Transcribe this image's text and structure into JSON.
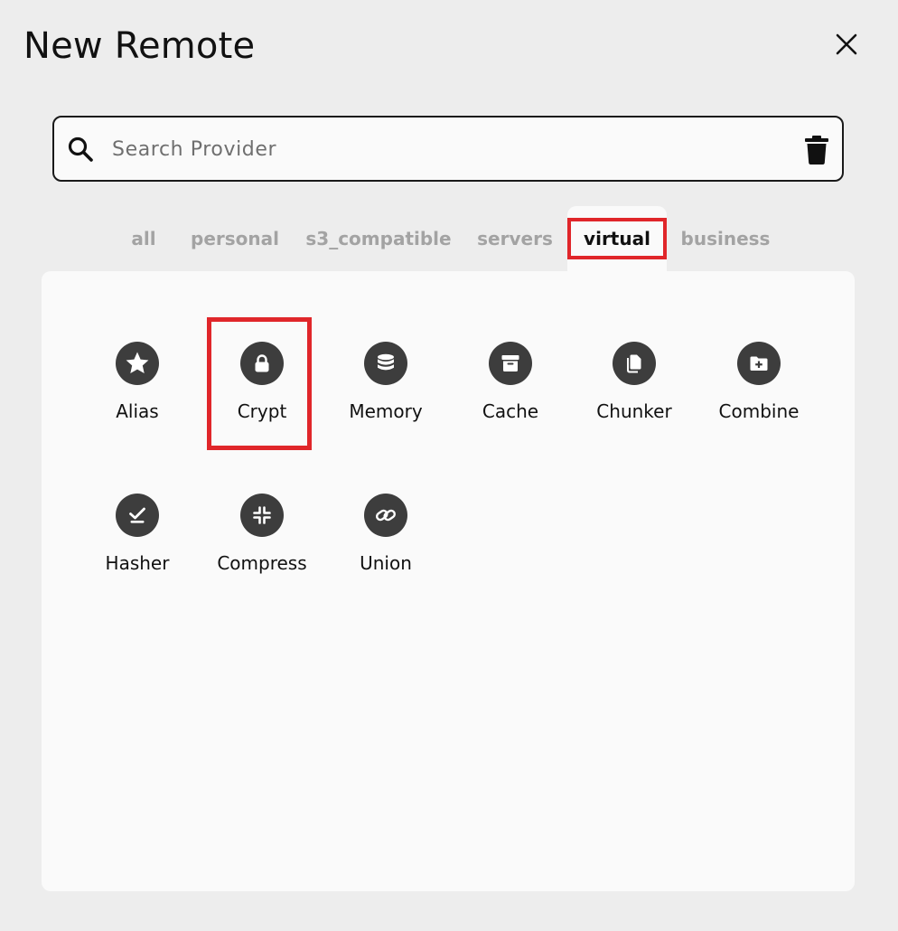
{
  "dialog": {
    "title": "New Remote",
    "close_icon": "close-icon"
  },
  "search": {
    "placeholder": "Search Provider",
    "value": "",
    "search_icon": "search-icon",
    "clear_icon": "trash-icon"
  },
  "tabs": [
    {
      "label": "all",
      "active": false
    },
    {
      "label": "personal",
      "active": false
    },
    {
      "label": "s3_compatible",
      "active": false
    },
    {
      "label": "servers",
      "active": false
    },
    {
      "label": "virtual",
      "active": true
    },
    {
      "label": "business",
      "active": false
    }
  ],
  "providers": [
    {
      "label": "Alias",
      "icon": "star-icon"
    },
    {
      "label": "Crypt",
      "icon": "lock-icon",
      "highlighted": true
    },
    {
      "label": "Memory",
      "icon": "database-icon"
    },
    {
      "label": "Cache",
      "icon": "archive-icon"
    },
    {
      "label": "Chunker",
      "icon": "copy-icon"
    },
    {
      "label": "Combine",
      "icon": "folder-plus-icon"
    },
    {
      "label": "Hasher",
      "icon": "check-badge-icon"
    },
    {
      "label": "Compress",
      "icon": "compress-icon"
    },
    {
      "label": "Union",
      "icon": "link-icon"
    }
  ],
  "colors": {
    "highlight": "#e0262a",
    "icon_bg": "#3d3d3d",
    "panel_bg": "#fafafa",
    "page_bg": "#ededed"
  }
}
